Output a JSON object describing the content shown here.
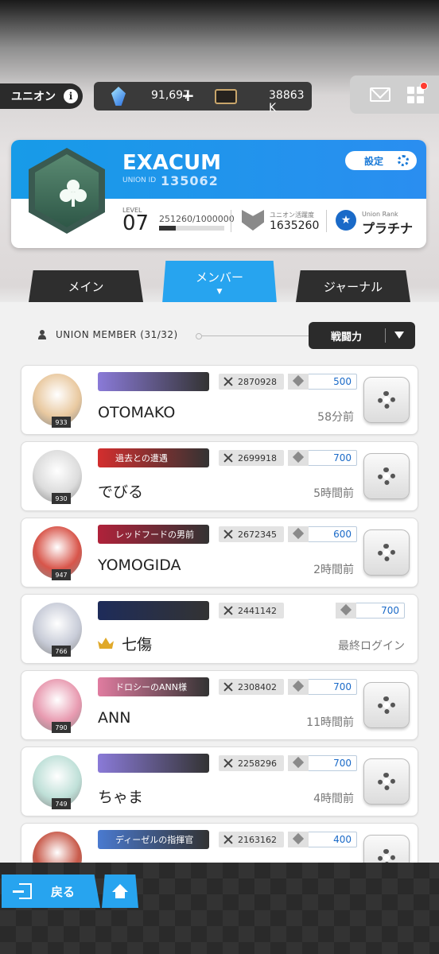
{
  "topbar": {
    "union_label": "ユニオン",
    "info_glyph": "i",
    "gem_amount": "91,697",
    "gem_plus": "+",
    "ticket_amount": "38863 K"
  },
  "union": {
    "name": "EXACUM",
    "id_label": "UNION ID",
    "id": "135062",
    "settings_label": "設定",
    "level_label": "LEVEL",
    "level": "07",
    "xp_text": "251260/1000000",
    "xp_fraction": 0.25126,
    "activity_label": "ユニオン活躍度",
    "activity_value": "1635260",
    "rank_label": "Union Rank",
    "rank_value": "プラチナ"
  },
  "tabs": [
    {
      "label": "メイン"
    },
    {
      "label": "メンバー",
      "arrow": "▼"
    },
    {
      "label": "ジャーナル"
    }
  ],
  "members_header": {
    "title": "UNION MEMBER (31/32)",
    "sort_label": "戦闘力"
  },
  "members": [
    {
      "name": "OTOMAKO",
      "level": "933",
      "banner": "",
      "banner_color": "#8a7ad8",
      "power": "2870928",
      "points": "500",
      "time": "58分前",
      "avatar_color": "#e9c9a0"
    },
    {
      "name": "でびる",
      "level": "930",
      "banner": "過去との遭遇",
      "banner_color": "#d32e2e",
      "power": "2699918",
      "points": "700",
      "time": "5時間前",
      "avatar_color": "#dcdcdc"
    },
    {
      "name": "YOMOGIDA",
      "level": "947",
      "banner": "レッドフードの男前",
      "banner_color": "#b0223a",
      "power": "2672345",
      "points": "600",
      "time": "2時間前",
      "avatar_color": "#d8554a"
    },
    {
      "name": "七傷",
      "level": "766",
      "banner": "",
      "banner_color": "#1e2c5a",
      "power": "2441142",
      "points": "700",
      "time": "最終ログイン",
      "avatar_color": "#c8ccd8",
      "leader": true
    },
    {
      "name": "ANN",
      "level": "790",
      "banner": "ドロシーのANN様",
      "banner_color": "#e07ca0",
      "power": "2308402",
      "points": "700",
      "time": "11時間前",
      "avatar_color": "#e89ab0"
    },
    {
      "name": "ちゃま",
      "level": "749",
      "banner": "",
      "banner_color": "#8a7ad8",
      "power": "2258296",
      "points": "700",
      "time": "4時間前",
      "avatar_color": "#bfe0d8"
    },
    {
      "name": "",
      "level": "",
      "banner": "ディーゼルの指揮官",
      "banner_color": "#4a7ad0",
      "power": "2163162",
      "points": "400",
      "time": "",
      "avatar_color": "#c85a4a"
    }
  ],
  "bottom": {
    "back_label": "戻る"
  }
}
